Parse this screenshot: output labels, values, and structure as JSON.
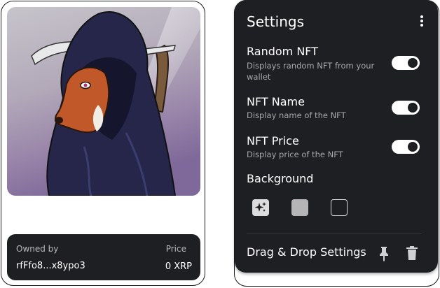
{
  "nft_card": {
    "image_alt": "Hooded fox artwork",
    "owned_by_label": "Owned by",
    "owner_address": "rfFfo8...x8ypo3",
    "price_label": "Price",
    "price_value": "0 XRP"
  },
  "settings": {
    "title": "Settings",
    "menu_icon": "kebab-menu-icon",
    "items": [
      {
        "name": "Random NFT",
        "description": "Displays random NFT from your wallet",
        "enabled": true
      },
      {
        "name": "NFT Name",
        "description": "Display name of the NFT",
        "enabled": true
      },
      {
        "name": "NFT Price",
        "description": "Display price of the NFT",
        "enabled": true
      }
    ],
    "background_title": "Background",
    "background_options": [
      "sparkle-icon",
      "gray-swatch",
      "dark-swatch"
    ],
    "drag_drop_label": "Drag & Drop Settings",
    "pin_icon": "pin-icon",
    "trash_icon": "trash-icon"
  },
  "colors": {
    "panel_bg": "#1e1f23",
    "toggle_on": "#ffffff",
    "muted_text": "#a7a8ad"
  }
}
